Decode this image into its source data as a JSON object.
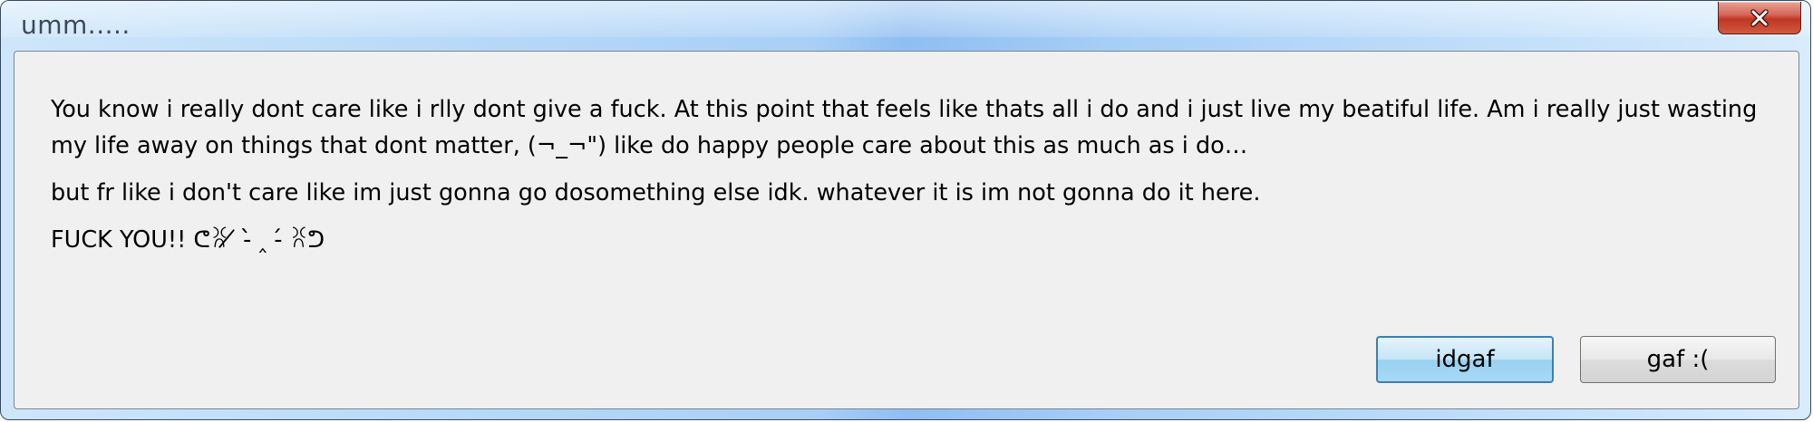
{
  "window": {
    "title": "umm.....",
    "close_icon": "close-icon"
  },
  "message": {
    "paragraphs": [
      "You know i really dont care like i rlly dont give a fuck. At this point that feels like thats all i do and i just live my beatiful life. Am i really just wasting my life away on things that dont matter, (¬_¬\") like do happy people care about this as much as i do…",
      "but fr like i don't care like im just gonna go dosomething else idk. whatever it is im not gonna do it here.",
      "FUCK YOU!! ᕦꐦ ̸̸ -̀̀ ‸ -́ ꐦᕤ"
    ]
  },
  "buttons": {
    "primary_label": "idgaf",
    "secondary_label": "gaf :("
  },
  "colors": {
    "title_bar_accent": "#a9cff6",
    "close_button": "#c03623",
    "client_background": "#f0f0f0",
    "primary_button_border": "#3c7fb1"
  }
}
